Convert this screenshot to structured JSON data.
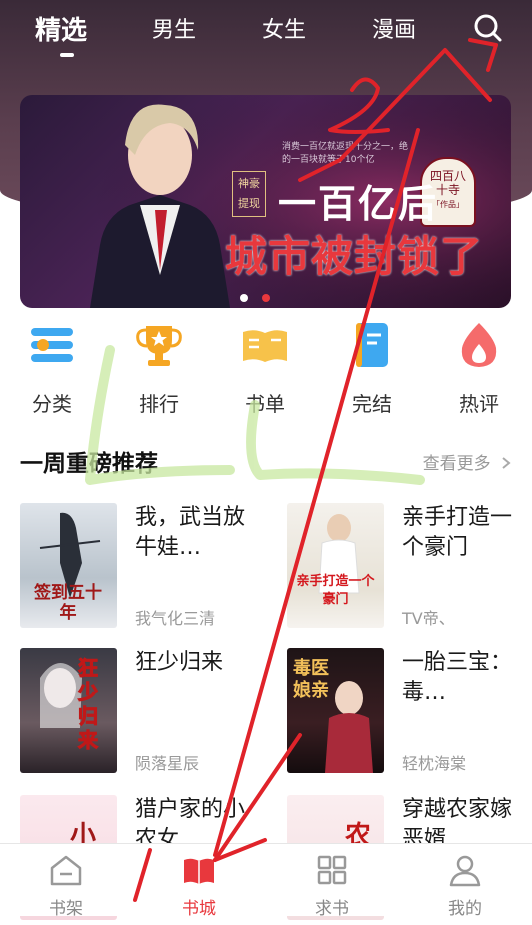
{
  "header": {
    "tabs": [
      {
        "label": "精选",
        "active": true
      },
      {
        "label": "男生",
        "active": false
      },
      {
        "label": "女生",
        "active": false
      },
      {
        "label": "漫画",
        "active": false
      }
    ],
    "search_icon": "search-icon"
  },
  "banner": {
    "tag_left": "神豪提现",
    "headline": "一百亿后",
    "subheadline": "城市被封锁了",
    "badge": "四百八十寺",
    "badge_sub": "「作品」",
    "blurb": "消费一百亿就返现十分之一，绝的一百块就等于10个亿",
    "dots": [
      {
        "active": false
      },
      {
        "active": true
      }
    ]
  },
  "categories": [
    {
      "label": "分类",
      "icon": "category-list-icon",
      "color": "#3ea8f0"
    },
    {
      "label": "排行",
      "icon": "trophy-icon",
      "color": "#f5a623"
    },
    {
      "label": "书单",
      "icon": "open-book-icon",
      "color": "#f7c24a"
    },
    {
      "label": "完结",
      "icon": "notebook-icon",
      "color": "#3ea8f0"
    },
    {
      "label": "热评",
      "icon": "flame-icon",
      "color": "#f56b6b"
    }
  ],
  "section": {
    "title": "一周重磅推荐",
    "more": "查看更多",
    "more_icon": "chevron-right-icon"
  },
  "books": [
    {
      "title": "我，武当放牛娃…",
      "author": "我气化三清",
      "cover_text": "签到五十年"
    },
    {
      "title": "亲手打造一个豪门",
      "author": "TV帝、",
      "cover_text": "亲手打造一个豪门"
    },
    {
      "title": "狂少归来",
      "author": "陨落星辰",
      "cover_text": "狂少归来"
    },
    {
      "title": "一胎三宝：毒…",
      "author": "轻枕海棠",
      "cover_text": "毒医娘亲"
    },
    {
      "title": "猎户家的小农女",
      "author": "",
      "cover_text": "小"
    },
    {
      "title": "穿越农家嫁恶婿",
      "author": "",
      "cover_text": "农"
    }
  ],
  "tabbar": [
    {
      "label": "书架",
      "icon": "bookshelf-icon",
      "active": false
    },
    {
      "label": "书城",
      "icon": "book-city-icon",
      "active": true
    },
    {
      "label": "求书",
      "icon": "grid-icon",
      "active": false
    },
    {
      "label": "我的",
      "icon": "user-icon",
      "active": false
    }
  ],
  "colors": {
    "accent": "#e8383d",
    "header_bg": "#4a3444",
    "annotation_red": "#e0232a",
    "annotation_green": "#c8e8a0"
  },
  "annotations": {
    "number": "2"
  }
}
